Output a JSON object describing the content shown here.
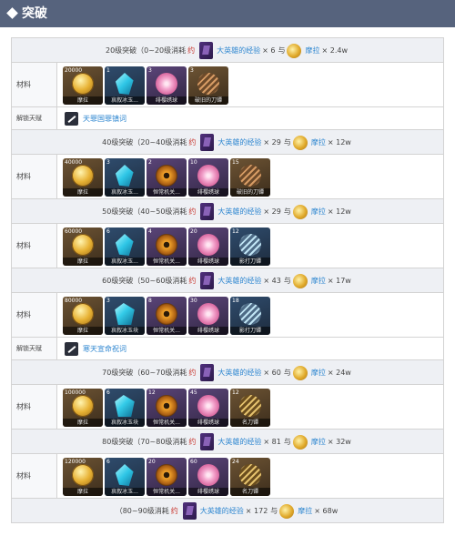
{
  "page": {
    "title": "突破"
  },
  "labels": {
    "materials": "材料",
    "unlock_talent": "解锁天赋"
  },
  "colors": {
    "link": "#2d86d0",
    "consume": "#c8352d",
    "header_bar": "#56637d"
  },
  "tiers": [
    {
      "header": {
        "prefix": "20级突破（0~20级消耗",
        "consume": "约",
        "exp_name": "大英雄的经验",
        "exp_qty": "× 6",
        "with": "与",
        "coin_name": "摩拉",
        "coin_qty": "× 2.4w"
      },
      "items": [
        {
          "count": "20000",
          "name": "摩拉",
          "icon": "mora-coin-icon"
        },
        {
          "count": "1",
          "name": "哀叙冰玉...",
          "icon": "crystal-icon"
        },
        {
          "count": "3",
          "name": "绯樱绣球",
          "icon": "flower-icon"
        },
        {
          "count": "3",
          "name": "破旧的刀镡",
          "icon": "blade-guard-icon"
        }
      ],
      "talent": {
        "name": "天罪国罪镇词"
      }
    },
    {
      "header": {
        "prefix": "40级突破（20~40级消耗",
        "consume": "约",
        "exp_name": "大英雄的经验",
        "exp_qty": "× 29",
        "with": "与",
        "coin_name": "摩拉",
        "coin_qty": "× 12w"
      },
      "items": [
        {
          "count": "40000",
          "name": "摩拉",
          "icon": "mora-coin-icon"
        },
        {
          "count": "3",
          "name": "哀叙冰玉...",
          "icon": "crystal-icon"
        },
        {
          "count": "2",
          "name": "恒常机关...",
          "icon": "gear-icon"
        },
        {
          "count": "10",
          "name": "绯樱绣球",
          "icon": "flower-icon"
        },
        {
          "count": "15",
          "name": "破旧的刀镡",
          "icon": "blade-guard-icon"
        }
      ]
    },
    {
      "header": {
        "prefix": "50级突破（40~50级消耗",
        "consume": "约",
        "exp_name": "大英雄的经验",
        "exp_qty": "× 29",
        "with": "与",
        "coin_name": "摩拉",
        "coin_qty": "× 12w"
      },
      "items": [
        {
          "count": "60000",
          "name": "摩拉",
          "icon": "mora-coin-icon"
        },
        {
          "count": "6",
          "name": "哀叙冰玉...",
          "icon": "crystal-icon"
        },
        {
          "count": "4",
          "name": "恒常机关...",
          "icon": "gear-icon"
        },
        {
          "count": "20",
          "name": "绯樱绣球",
          "icon": "flower-icon"
        },
        {
          "count": "12",
          "name": "影打刀镡",
          "icon": "blade-guard-blue-icon"
        }
      ]
    },
    {
      "header": {
        "prefix": "60级突破（50~60级消耗",
        "consume": "约",
        "exp_name": "大英雄的经验",
        "exp_qty": "× 43",
        "with": "与",
        "coin_name": "摩拉",
        "coin_qty": "× 17w"
      },
      "items": [
        {
          "count": "80000",
          "name": "摩拉",
          "icon": "mora-coin-icon"
        },
        {
          "count": "3",
          "name": "哀叙冰玉块",
          "icon": "crystal-large-icon"
        },
        {
          "count": "8",
          "name": "恒常机关...",
          "icon": "gear-icon"
        },
        {
          "count": "30",
          "name": "绯樱绣球",
          "icon": "flower-icon"
        },
        {
          "count": "18",
          "name": "影打刀镡",
          "icon": "blade-guard-blue-icon"
        }
      ],
      "talent": {
        "name": "寒天宣命祝词"
      }
    },
    {
      "header": {
        "prefix": "70级突破（60~70级消耗",
        "consume": "约",
        "exp_name": "大英雄的经验",
        "exp_qty": "× 60",
        "with": "与",
        "coin_name": "摩拉",
        "coin_qty": "× 24w"
      },
      "items": [
        {
          "count": "100000",
          "name": "摩拉",
          "icon": "mora-coin-icon"
        },
        {
          "count": "6",
          "name": "哀叙冰玉块",
          "icon": "crystal-large-icon"
        },
        {
          "count": "12",
          "name": "恒常机关...",
          "icon": "gear-icon"
        },
        {
          "count": "45",
          "name": "绯樱绣球",
          "icon": "flower-icon"
        },
        {
          "count": "12",
          "name": "名刀镡",
          "icon": "blade-guard-gold-icon"
        }
      ]
    },
    {
      "header": {
        "prefix": "80级突破（70~80级消耗",
        "consume": "约",
        "exp_name": "大英雄的经验",
        "exp_qty": "× 81",
        "with": "与",
        "coin_name": "摩拉",
        "coin_qty": "× 32w"
      },
      "items": [
        {
          "count": "120000",
          "name": "摩拉",
          "icon": "mora-coin-icon"
        },
        {
          "count": "6",
          "name": "哀叙冰玉...",
          "icon": "crystal-icon"
        },
        {
          "count": "20",
          "name": "恒常机关...",
          "icon": "gear-icon"
        },
        {
          "count": "60",
          "name": "绯樱绣球",
          "icon": "flower-icon"
        },
        {
          "count": "24",
          "name": "名刀镡",
          "icon": "blade-guard-gold-icon"
        }
      ]
    }
  ],
  "final": {
    "prefix": "（80~90级消耗",
    "consume": "约",
    "exp_name": "大英雄的经验",
    "exp_qty": "× 172",
    "with": "与",
    "coin_name": "摩拉",
    "coin_qty": "× 68w"
  }
}
